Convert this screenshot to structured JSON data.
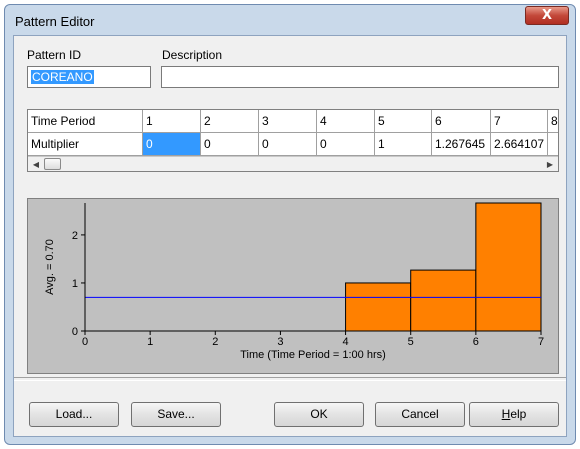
{
  "window": {
    "title": "Pattern Editor",
    "close_label": "X"
  },
  "form": {
    "pattern_id_label": "Pattern ID",
    "pattern_id_value": "COREANO",
    "description_label": "Description",
    "description_value": ""
  },
  "grid": {
    "row1_header": "Time Period",
    "row2_header": "Multiplier",
    "periods": [
      "1",
      "2",
      "3",
      "4",
      "5",
      "6",
      "7",
      "8"
    ],
    "multipliers": [
      "0",
      "0",
      "0",
      "0",
      "1",
      "1.267645",
      "2.664107",
      ""
    ],
    "selected_column": 0
  },
  "chart_data": {
    "type": "bar",
    "x_bins": [
      [
        0,
        1
      ],
      [
        1,
        2
      ],
      [
        2,
        3
      ],
      [
        3,
        4
      ],
      [
        4,
        5
      ],
      [
        5,
        6
      ],
      [
        6,
        7
      ]
    ],
    "values": [
      0,
      0,
      0,
      0,
      1,
      1.267645,
      2.664107
    ],
    "average": 0.7,
    "ylabel": "Avg. = 0.70",
    "xlabel": "Time (Time Period = 1:00  hrs)",
    "x_ticks": [
      "0",
      "1",
      "2",
      "3",
      "4",
      "5",
      "6",
      "7"
    ],
    "y_ticks": [
      "0",
      "1",
      "2"
    ],
    "xlim": [
      0,
      7
    ],
    "ylim": [
      0,
      2.664107
    ],
    "bar_color": "#ff8000",
    "average_line_color": "#0000ff",
    "background_color": "#c0c0c0",
    "plot_area_color": "#c0c0c0"
  },
  "buttons": {
    "load": "Load...",
    "save": "Save...",
    "ok": "OK",
    "cancel": "Cancel",
    "help": "Help"
  }
}
